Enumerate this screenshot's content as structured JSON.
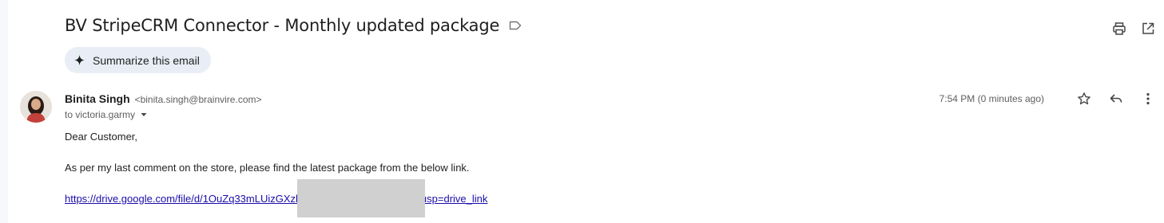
{
  "email": {
    "subject": "BV StripeCRM Connector - Monthly updated package",
    "summarize_label": "Summarize this email",
    "sender": {
      "name": "Binita Singh",
      "email": "<binita.singh@brainvire.com>"
    },
    "recipient": "to victoria.garmy",
    "timestamp": "7:54 PM (0 minutes ago)",
    "body": {
      "greeting": "Dear Customer,",
      "paragraph": "As per my last comment on the store, please find the latest package from the below link.",
      "link_prefix": "https://drive.google.com/file/d/1OuZq33mLUizGXzl",
      "link_suffix": "usp=drive_link"
    }
  },
  "icons": {
    "label": "label-icon",
    "print": "print-icon",
    "open_new_window": "open-in-new-window-icon",
    "sparkle": "sparkle-icon",
    "star": "star-icon",
    "reply": "reply-icon",
    "more": "more-vert-icon",
    "caret": "caret-down-icon"
  },
  "colors": {
    "summarize_bg": "#e9eef6",
    "link": "#1a0dab",
    "redaction": "#d0d0d0"
  }
}
